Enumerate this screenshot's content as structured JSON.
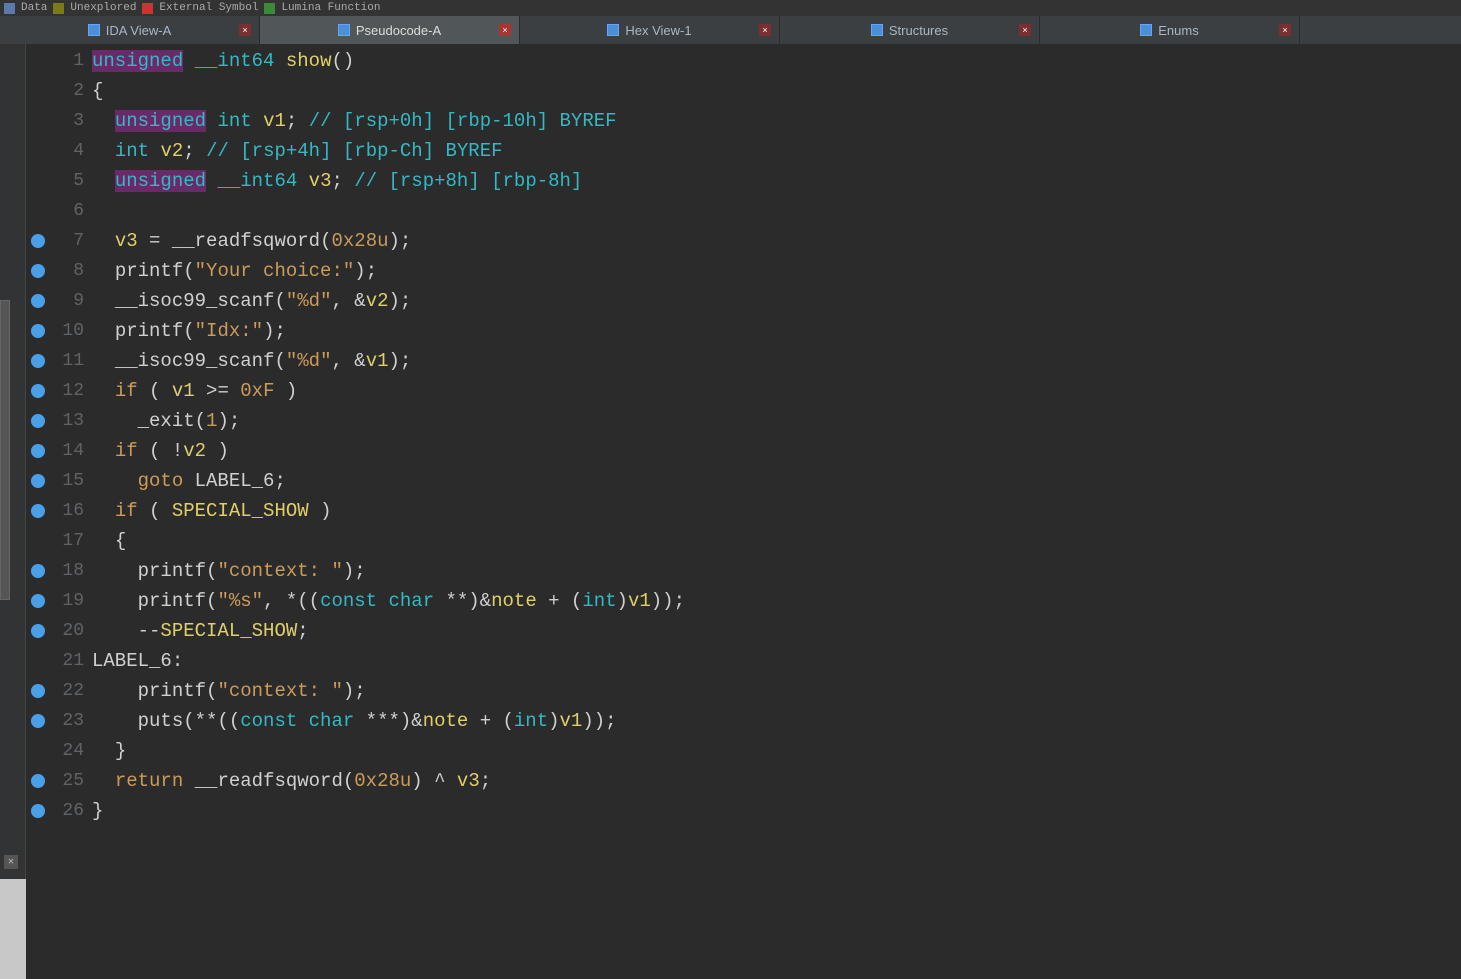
{
  "topbar": {
    "t1": "Data",
    "t2": "Unexplored",
    "t3": "External Symbol",
    "t4": "Lumina Function"
  },
  "tabs": [
    {
      "label": "IDA View-A",
      "active": false
    },
    {
      "label": "Pseudocode-A",
      "active": true
    },
    {
      "label": "Hex View-1",
      "active": false
    },
    {
      "label": "Structures",
      "active": false
    },
    {
      "label": "Enums",
      "active": false
    }
  ],
  "code": {
    "lines": [
      {
        "n": 1,
        "bp": false,
        "parts": [
          {
            "cls": "kw-type hl",
            "t": "unsigned"
          },
          {
            "cls": "",
            "t": " "
          },
          {
            "cls": "kw-type",
            "t": "__int64"
          },
          {
            "cls": "",
            "t": " "
          },
          {
            "cls": "var",
            "t": "show"
          },
          {
            "cls": "paren",
            "t": "()"
          }
        ]
      },
      {
        "n": 2,
        "bp": false,
        "parts": [
          {
            "cls": "paren",
            "t": "{"
          }
        ]
      },
      {
        "n": 3,
        "bp": false,
        "parts": [
          {
            "cls": "",
            "t": "  "
          },
          {
            "cls": "kw-type hl",
            "t": "unsigned"
          },
          {
            "cls": "",
            "t": " "
          },
          {
            "cls": "kw-type",
            "t": "int"
          },
          {
            "cls": "",
            "t": " "
          },
          {
            "cls": "var",
            "t": "v1"
          },
          {
            "cls": "op",
            "t": "; "
          },
          {
            "cls": "cmt",
            "t": "// [rsp+0h] [rbp-10h] BYREF"
          }
        ]
      },
      {
        "n": 4,
        "bp": false,
        "parts": [
          {
            "cls": "",
            "t": "  "
          },
          {
            "cls": "kw-type",
            "t": "int"
          },
          {
            "cls": "",
            "t": " "
          },
          {
            "cls": "var",
            "t": "v2"
          },
          {
            "cls": "op",
            "t": "; "
          },
          {
            "cls": "cmt",
            "t": "// [rsp+4h] [rbp-Ch] BYREF"
          }
        ]
      },
      {
        "n": 5,
        "bp": false,
        "parts": [
          {
            "cls": "",
            "t": "  "
          },
          {
            "cls": "kw-type hl",
            "t": "unsigned"
          },
          {
            "cls": "",
            "t": " "
          },
          {
            "cls": "kw-type",
            "t": "__int64"
          },
          {
            "cls": "",
            "t": " "
          },
          {
            "cls": "var",
            "t": "v3"
          },
          {
            "cls": "op",
            "t": "; "
          },
          {
            "cls": "cmt",
            "t": "// [rsp+8h] [rbp-8h]"
          }
        ]
      },
      {
        "n": 6,
        "bp": false,
        "parts": [
          {
            "cls": "",
            "t": ""
          }
        ]
      },
      {
        "n": 7,
        "bp": true,
        "parts": [
          {
            "cls": "",
            "t": "  "
          },
          {
            "cls": "var",
            "t": "v3"
          },
          {
            "cls": "op",
            "t": " = "
          },
          {
            "cls": "func",
            "t": "__readfsqword"
          },
          {
            "cls": "paren",
            "t": "("
          },
          {
            "cls": "num",
            "t": "0x28u"
          },
          {
            "cls": "paren",
            "t": ")"
          },
          {
            "cls": "op",
            "t": ";"
          }
        ]
      },
      {
        "n": 8,
        "bp": true,
        "parts": [
          {
            "cls": "",
            "t": "  "
          },
          {
            "cls": "func",
            "t": "printf"
          },
          {
            "cls": "paren",
            "t": "("
          },
          {
            "cls": "str",
            "t": "\"Your choice:\""
          },
          {
            "cls": "paren",
            "t": ")"
          },
          {
            "cls": "op",
            "t": ";"
          }
        ]
      },
      {
        "n": 9,
        "bp": true,
        "parts": [
          {
            "cls": "",
            "t": "  "
          },
          {
            "cls": "func",
            "t": "__isoc99_scanf"
          },
          {
            "cls": "paren",
            "t": "("
          },
          {
            "cls": "str",
            "t": "\"%d\""
          },
          {
            "cls": "op",
            "t": ", &"
          },
          {
            "cls": "var",
            "t": "v2"
          },
          {
            "cls": "paren",
            "t": ")"
          },
          {
            "cls": "op",
            "t": ";"
          }
        ]
      },
      {
        "n": 10,
        "bp": true,
        "parts": [
          {
            "cls": "",
            "t": "  "
          },
          {
            "cls": "func",
            "t": "printf"
          },
          {
            "cls": "paren",
            "t": "("
          },
          {
            "cls": "str",
            "t": "\"Idx:\""
          },
          {
            "cls": "paren",
            "t": ")"
          },
          {
            "cls": "op",
            "t": ";"
          }
        ]
      },
      {
        "n": 11,
        "bp": true,
        "parts": [
          {
            "cls": "",
            "t": "  "
          },
          {
            "cls": "func",
            "t": "__isoc99_scanf"
          },
          {
            "cls": "paren",
            "t": "("
          },
          {
            "cls": "str",
            "t": "\"%d\""
          },
          {
            "cls": "op",
            "t": ", &"
          },
          {
            "cls": "var",
            "t": "v1"
          },
          {
            "cls": "paren",
            "t": ")"
          },
          {
            "cls": "op",
            "t": ";"
          }
        ]
      },
      {
        "n": 12,
        "bp": true,
        "parts": [
          {
            "cls": "",
            "t": "  "
          },
          {
            "cls": "kw-ctrl",
            "t": "if"
          },
          {
            "cls": "op",
            "t": " ( "
          },
          {
            "cls": "var",
            "t": "v1"
          },
          {
            "cls": "op",
            "t": " >= "
          },
          {
            "cls": "num",
            "t": "0xF"
          },
          {
            "cls": "op",
            "t": " )"
          }
        ]
      },
      {
        "n": 13,
        "bp": true,
        "parts": [
          {
            "cls": "",
            "t": "    "
          },
          {
            "cls": "func",
            "t": "_exit"
          },
          {
            "cls": "paren",
            "t": "("
          },
          {
            "cls": "num",
            "t": "1"
          },
          {
            "cls": "paren",
            "t": ")"
          },
          {
            "cls": "op",
            "t": ";"
          }
        ]
      },
      {
        "n": 14,
        "bp": true,
        "parts": [
          {
            "cls": "",
            "t": "  "
          },
          {
            "cls": "kw-ctrl",
            "t": "if"
          },
          {
            "cls": "op",
            "t": " ( !"
          },
          {
            "cls": "var",
            "t": "v2"
          },
          {
            "cls": "op",
            "t": " )"
          }
        ]
      },
      {
        "n": 15,
        "bp": true,
        "parts": [
          {
            "cls": "",
            "t": "    "
          },
          {
            "cls": "kw-ctrl",
            "t": "goto"
          },
          {
            "cls": "op",
            "t": " "
          },
          {
            "cls": "ident",
            "t": "LABEL_6"
          },
          {
            "cls": "op",
            "t": ";"
          }
        ]
      },
      {
        "n": 16,
        "bp": true,
        "parts": [
          {
            "cls": "",
            "t": "  "
          },
          {
            "cls": "kw-ctrl",
            "t": "if"
          },
          {
            "cls": "op",
            "t": " ( "
          },
          {
            "cls": "var",
            "t": "SPECIAL_SHOW"
          },
          {
            "cls": "op",
            "t": " )"
          }
        ]
      },
      {
        "n": 17,
        "bp": false,
        "parts": [
          {
            "cls": "",
            "t": "  "
          },
          {
            "cls": "paren",
            "t": "{"
          }
        ]
      },
      {
        "n": 18,
        "bp": true,
        "parts": [
          {
            "cls": "",
            "t": "    "
          },
          {
            "cls": "func",
            "t": "printf"
          },
          {
            "cls": "paren",
            "t": "("
          },
          {
            "cls": "str",
            "t": "\"context: \""
          },
          {
            "cls": "paren",
            "t": ")"
          },
          {
            "cls": "op",
            "t": ";"
          }
        ]
      },
      {
        "n": 19,
        "bp": true,
        "parts": [
          {
            "cls": "",
            "t": "    "
          },
          {
            "cls": "func",
            "t": "printf"
          },
          {
            "cls": "paren",
            "t": "("
          },
          {
            "cls": "str",
            "t": "\"%s\""
          },
          {
            "cls": "op",
            "t": ", *(("
          },
          {
            "cls": "kw-type",
            "t": "const"
          },
          {
            "cls": "op",
            "t": " "
          },
          {
            "cls": "kw-type",
            "t": "char"
          },
          {
            "cls": "op",
            "t": " **)&"
          },
          {
            "cls": "var",
            "t": "note"
          },
          {
            "cls": "op",
            "t": " + ("
          },
          {
            "cls": "kw-type",
            "t": "int"
          },
          {
            "cls": "op",
            "t": ")"
          },
          {
            "cls": "var",
            "t": "v1"
          },
          {
            "cls": "op",
            "t": "));"
          }
        ]
      },
      {
        "n": 20,
        "bp": true,
        "parts": [
          {
            "cls": "",
            "t": "    --"
          },
          {
            "cls": "var",
            "t": "SPECIAL_SHOW"
          },
          {
            "cls": "op",
            "t": ";"
          }
        ]
      },
      {
        "n": 21,
        "bp": false,
        "parts": [
          {
            "cls": "ident",
            "t": "LABEL_6:"
          }
        ]
      },
      {
        "n": 22,
        "bp": true,
        "parts": [
          {
            "cls": "",
            "t": "    "
          },
          {
            "cls": "func",
            "t": "printf"
          },
          {
            "cls": "paren",
            "t": "("
          },
          {
            "cls": "str",
            "t": "\"context: \""
          },
          {
            "cls": "paren",
            "t": ")"
          },
          {
            "cls": "op",
            "t": ";"
          }
        ]
      },
      {
        "n": 23,
        "bp": true,
        "parts": [
          {
            "cls": "",
            "t": "    "
          },
          {
            "cls": "func",
            "t": "puts"
          },
          {
            "cls": "paren",
            "t": "("
          },
          {
            "cls": "op",
            "t": "**(("
          },
          {
            "cls": "kw-type",
            "t": "const"
          },
          {
            "cls": "op",
            "t": " "
          },
          {
            "cls": "kw-type",
            "t": "char"
          },
          {
            "cls": "op",
            "t": " ***)&"
          },
          {
            "cls": "var",
            "t": "note"
          },
          {
            "cls": "op",
            "t": " + ("
          },
          {
            "cls": "kw-type",
            "t": "int"
          },
          {
            "cls": "op",
            "t": ")"
          },
          {
            "cls": "var",
            "t": "v1"
          },
          {
            "cls": "op",
            "t": "));"
          }
        ]
      },
      {
        "n": 24,
        "bp": false,
        "parts": [
          {
            "cls": "",
            "t": "  "
          },
          {
            "cls": "paren",
            "t": "}"
          }
        ]
      },
      {
        "n": 25,
        "bp": true,
        "parts": [
          {
            "cls": "",
            "t": "  "
          },
          {
            "cls": "kw-ctrl",
            "t": "return"
          },
          {
            "cls": "op",
            "t": " "
          },
          {
            "cls": "func",
            "t": "__readfsqword"
          },
          {
            "cls": "paren",
            "t": "("
          },
          {
            "cls": "num",
            "t": "0x28u"
          },
          {
            "cls": "paren",
            "t": ")"
          },
          {
            "cls": "op",
            "t": " ^ "
          },
          {
            "cls": "var",
            "t": "v3"
          },
          {
            "cls": "op",
            "t": ";"
          }
        ]
      },
      {
        "n": 26,
        "bp": true,
        "parts": [
          {
            "cls": "paren",
            "t": "}"
          }
        ]
      }
    ]
  }
}
